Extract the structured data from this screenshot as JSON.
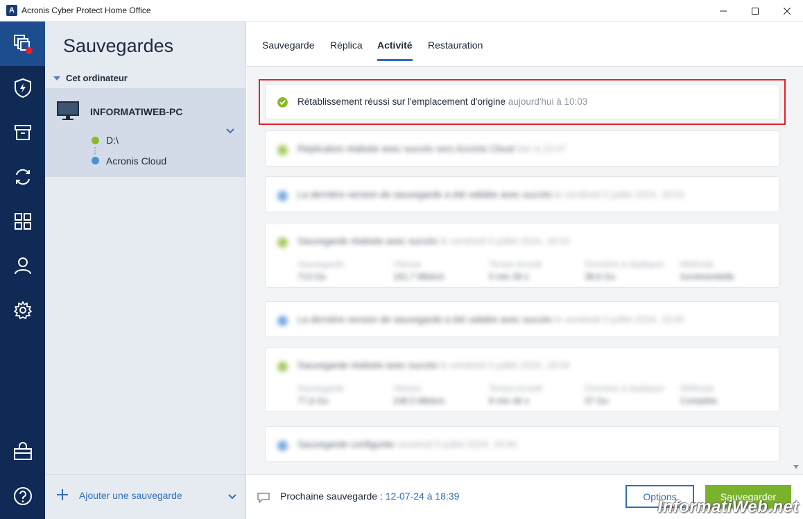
{
  "window": {
    "title": "Acronis Cyber Protect Home Office",
    "logo_letter": "A"
  },
  "rail": {
    "items": [
      {
        "icon": "backup-copies-icon",
        "active": true
      },
      {
        "icon": "shield-icon"
      },
      {
        "icon": "archive-icon"
      },
      {
        "icon": "sync-icon"
      },
      {
        "icon": "tools-grid-icon"
      },
      {
        "icon": "account-icon"
      },
      {
        "icon": "settings-gear-icon"
      },
      {
        "icon": "store-bag-icon"
      },
      {
        "icon": "help-icon"
      }
    ]
  },
  "sidebar": {
    "title": "Sauvegardes",
    "group_label": "Cet ordinateur",
    "machine": {
      "name": "INFORMATIWEB-PC",
      "source": "D:\\",
      "destination": "Acronis Cloud"
    },
    "add_label": "Ajouter une sauvegarde"
  },
  "tabs": [
    {
      "label": "Sauvegarde"
    },
    {
      "label": "Réplica"
    },
    {
      "label": "Activité",
      "active": true
    },
    {
      "label": "Restauration"
    }
  ],
  "activity": [
    {
      "text": "Rétablissement réussi sur l'emplacement d'origine",
      "time": "aujourd'hui à 10:03",
      "status_color": "#8ab92d"
    },
    {
      "text": "Réplication réalisée avec succès vers Acronis Cloud",
      "time": "hier à 23:47",
      "status_color": "#8ab92d"
    },
    {
      "text": "La dernière version de sauvegarde a été validée avec succès",
      "time": "le vendredi 5 juillet 2024, 18:53",
      "status_color": "#4a90d9"
    },
    {
      "text": "Sauvegarde réalisée avec succès",
      "time": "le vendredi 5 juillet 2024, 18:03",
      "status_color": "#8ab92d",
      "stats": [
        {
          "label": "Sauvegarde",
          "value": "713 Go"
        },
        {
          "label": "Vitesse",
          "value": "181,7 Mbits/s"
        },
        {
          "label": "Temps écoulé",
          "value": "5 min 39 s"
        },
        {
          "label": "Données à dupliquer",
          "value": "38,6 Go"
        },
        {
          "label": "Méthode",
          "value": "Incrémentielle"
        }
      ]
    },
    {
      "text": "La dernière version de sauvegarde a été validée avec succès",
      "time": "le vendredi 5 juillet 2024, 19:00",
      "status_color": "#4a90d9"
    },
    {
      "text": "Sauvegarde réalisée avec succès",
      "time": "le vendredi 5 juillet 2024, 18:04",
      "status_color": "#8ab92d",
      "stats": [
        {
          "label": "Sauvegarde",
          "value": "77,6 Go"
        },
        {
          "label": "Vitesse",
          "value": "248,5 Mbits/s"
        },
        {
          "label": "Temps écoulé",
          "value": "8 min 46 s"
        },
        {
          "label": "Données à dupliquer",
          "value": "37 Go"
        },
        {
          "label": "Méthode",
          "value": "Complète"
        }
      ]
    },
    {
      "text": "Sauvegarde configurée",
      "time": "vendredi 5 juillet 2024, 18:44",
      "status_color": "#4a90d9"
    }
  ],
  "footer": {
    "next_label": "Prochaine sauvegarde :",
    "next_value": "12-07-24 à 18:39",
    "options_label": "Options",
    "save_label": "Sauvegarder"
  },
  "watermark": "InformatiWeb.net"
}
